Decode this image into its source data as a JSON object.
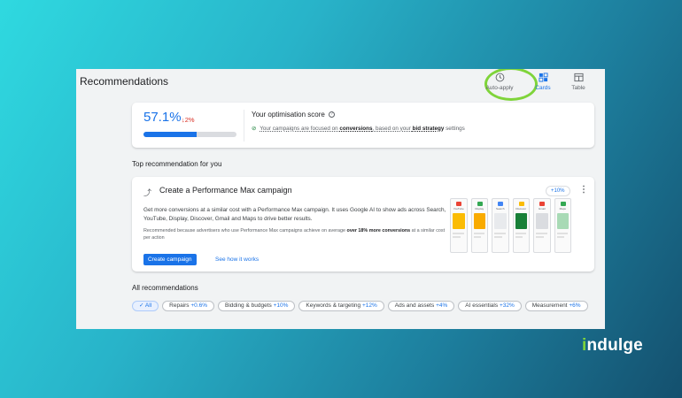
{
  "page_title": "Recommendations",
  "view_switch": [
    {
      "label": "Auto-apply",
      "icon": "clock-icon"
    },
    {
      "label": "Cards",
      "icon": "cards-icon",
      "active": true
    },
    {
      "label": "Table",
      "icon": "table-icon"
    }
  ],
  "score": {
    "value": "57.1%",
    "change": "↓2%",
    "progress": 0.571,
    "title": "Your optimisation score",
    "sub_pre": "Your campaigns are focused on ",
    "sub_b1": "conversions",
    "sub_mid": ", based on your ",
    "sub_b2": "bid strategy",
    "sub_post": " settings"
  },
  "top_section_label": "Top recommendation for you",
  "top_rec": {
    "title": "Create a Performance Max campaign",
    "description": "Get more conversions at a similar cost with a Performance Max campaign. It uses Google AI to show ads across Search, YouTube, Display, Discover, Gmail and Maps to drive better results.",
    "reason_pre": "Recommended because advertisers who use Performance Max campaigns achieve on average ",
    "reason_bold1": "over 18% more",
    "reason_bold2": "conversions",
    "reason_post": " at a similar cost per action",
    "primary_button": "Create campaign",
    "secondary_link": "See how it works",
    "impact": "+10%",
    "previews": [
      {
        "caption": "YouTube",
        "color": "#ea4335",
        "img": "#fbbc04"
      },
      {
        "caption": "Display",
        "color": "#34a853",
        "img": "#f9ab00"
      },
      {
        "caption": "Search",
        "color": "#4285f4",
        "img": "#e8eaed"
      },
      {
        "caption": "Discover",
        "color": "#fbbc04",
        "img": "#188038"
      },
      {
        "caption": "Gmail",
        "color": "#ea4335",
        "img": "#dadce0"
      },
      {
        "caption": "Maps",
        "color": "#34a853",
        "img": "#a8dab5"
      }
    ]
  },
  "all_section_label": "All recommendations",
  "filters": [
    {
      "label": "All",
      "selected": true
    },
    {
      "label": "Repairs",
      "uplift": "+0.6%"
    },
    {
      "label": "Bidding & budgets",
      "uplift": "+10%"
    },
    {
      "label": "Keywords & targeting",
      "uplift": "+12%"
    },
    {
      "label": "Ads and assets",
      "uplift": "+4%"
    },
    {
      "label": "AI essentials",
      "uplift": "+32%"
    },
    {
      "label": "Measurement",
      "uplift": "+6%"
    }
  ],
  "brand": {
    "accent_letter": "i",
    "rest": "ndulge",
    "accent_color": "#7fd43a"
  }
}
